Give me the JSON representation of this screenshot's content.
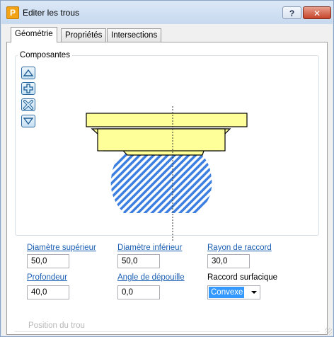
{
  "window": {
    "title": "Editer les trous",
    "app_icon_letter": "P",
    "help_label": "?",
    "close_label": "✕"
  },
  "tabs": [
    {
      "label": "Géométrie",
      "active": true
    },
    {
      "label": "Propriétés",
      "active": false
    },
    {
      "label": "Intersections",
      "active": false
    }
  ],
  "composantes": {
    "title": "Composantes",
    "buttons": [
      "move-up",
      "add",
      "delete",
      "move-down"
    ]
  },
  "fields": {
    "diametre_superieur": {
      "label": "Diamètre supérieur",
      "value": "50,0"
    },
    "diametre_inferieur": {
      "label": "Diamètre inférieur",
      "value": "50,0"
    },
    "rayon_de_raccord": {
      "label": "Rayon de raccord",
      "value": "30,0"
    },
    "profondeur": {
      "label": "Profondeur",
      "value": "40,0"
    },
    "angle_de_depouille": {
      "label": "Angle de dépouille",
      "value": "0,0"
    },
    "raccord_surfacique": {
      "label": "Raccord surfacique",
      "value": "Convexe"
    }
  },
  "position_du_trou": {
    "label": "Position du trou"
  },
  "colors": {
    "counterbore_fill": "#ffff99",
    "hatch": "#3d7fe0",
    "link": "#1a5fb4",
    "selection": "#3399ff"
  }
}
